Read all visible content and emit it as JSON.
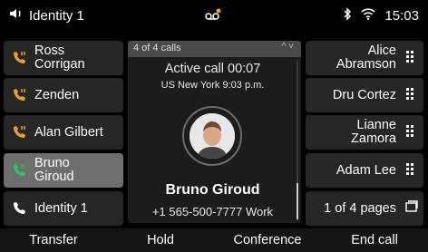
{
  "status_bar": {
    "identity": "Identity 1",
    "time": "15:03",
    "icons": [
      "speaker-icon",
      "voicemail-icon",
      "bluetooth-icon",
      "wifi-icon"
    ]
  },
  "left_lines": [
    {
      "label": "Ross\nCorrigan",
      "icon": "missed-call-icon"
    },
    {
      "label": "Zenden",
      "icon": "missed-call-icon"
    },
    {
      "label": "Alan Gilbert",
      "icon": "missed-call-icon"
    },
    {
      "label": "Bruno\nGiroud",
      "icon": "active-call-icon"
    },
    {
      "label": "Identity 1",
      "icon": "handset-icon"
    }
  ],
  "right_lines": [
    {
      "label": "Alice\nAbramson",
      "icon": "grid-icon"
    },
    {
      "label": "Dru Cortez",
      "icon": "grid-icon"
    },
    {
      "label": "Lianne\nZamora",
      "icon": "grid-icon"
    },
    {
      "label": "Adam Lee",
      "icon": "grid-icon"
    },
    {
      "label": "1 of 4 pages",
      "icon": "pages-icon"
    }
  ],
  "call": {
    "counter": "4 of 4 calls",
    "status": "Active call 00:07",
    "timezone": "US New York 9:03 p.m.",
    "caller_name": "Bruno Giroud",
    "caller_number": "+1 565-500-7777 Work"
  },
  "softkeys": [
    "Transfer",
    "Hold",
    "Conference",
    "End call"
  ],
  "colors": {
    "accent_orange": "#f0a020",
    "call_green": "#27c65a",
    "selected_bg": "#6e6e6e"
  }
}
